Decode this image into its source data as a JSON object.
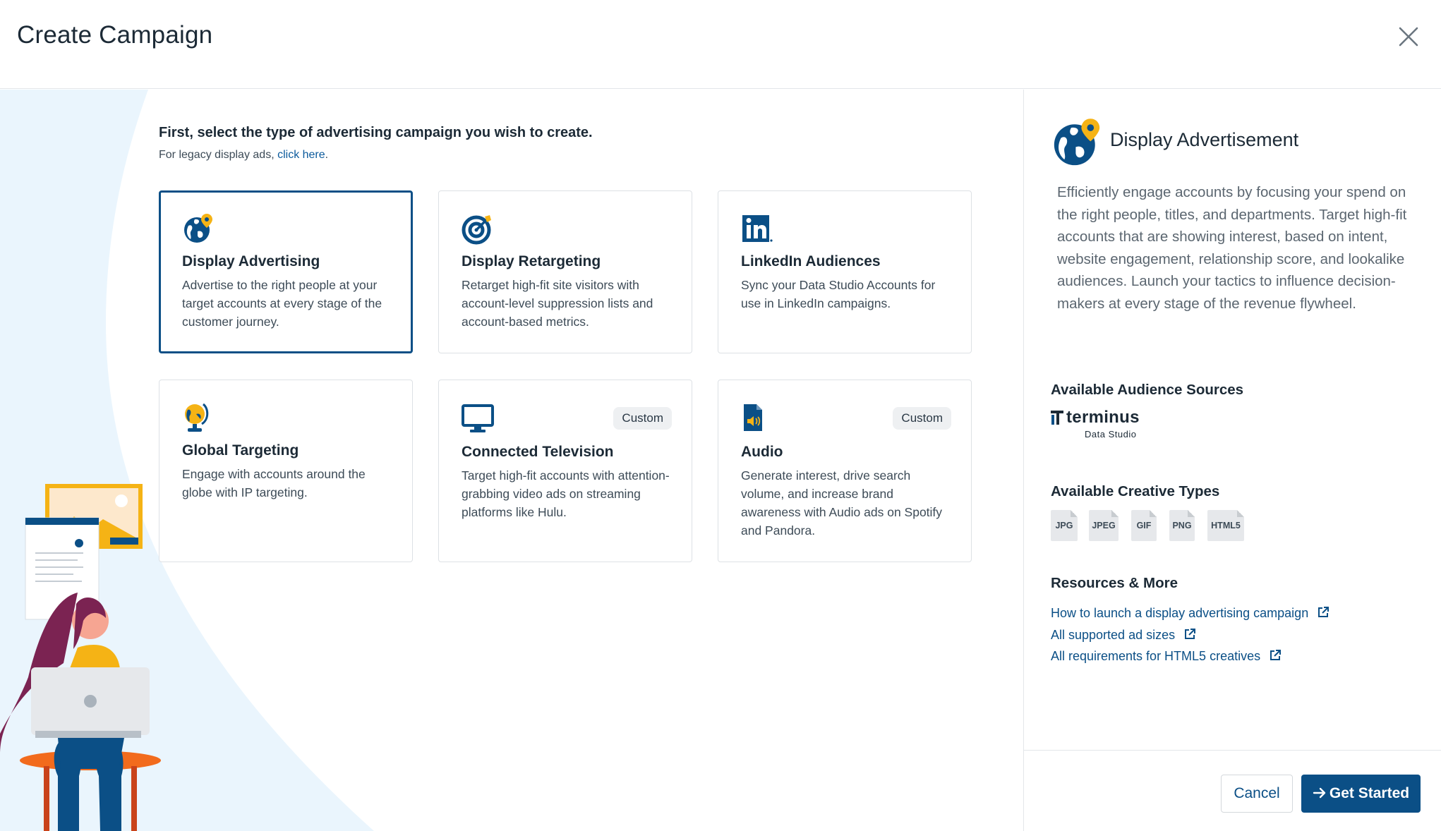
{
  "colors": {
    "accent": "#0b4f86",
    "highlight": "#f5b315",
    "muted_bg": "#eaf5fd"
  },
  "header": {
    "title": "Create Campaign",
    "close_icon": "close-icon"
  },
  "intro": {
    "heading": "First, select the type of advertising campaign you wish to create.",
    "legacy_prefix": "For legacy display ads, ",
    "legacy_link": "click here",
    "legacy_suffix": "."
  },
  "cards": [
    {
      "title": "Display Advertising",
      "desc": "Advertise to the right people at your target accounts at every stage of the customer journey.",
      "icon": "globe-pin-icon",
      "selected": true,
      "badge": ""
    },
    {
      "title": "Display Retargeting",
      "desc": "Retarget high-fit site visitors with account-level suppression lists and account-based metrics.",
      "icon": "target-icon",
      "selected": false,
      "badge": ""
    },
    {
      "title": "LinkedIn Audiences",
      "desc": "Sync your Data Studio Accounts for use in LinkedIn campaigns.",
      "icon": "linkedin-icon",
      "selected": false,
      "badge": ""
    },
    {
      "title": "Global Targeting",
      "desc": "Engage with accounts around the globe with IP targeting.",
      "icon": "desk-globe-icon",
      "selected": false,
      "badge": ""
    },
    {
      "title": "Connected Television",
      "desc": "Target high-fit accounts with attention-grabbing video ads on streaming platforms like Hulu.",
      "icon": "monitor-icon",
      "selected": false,
      "badge": "Custom"
    },
    {
      "title": "Audio",
      "desc": "Generate interest, drive search volume, and increase brand awareness with Audio ads on Spotify and Pandora.",
      "icon": "audio-file-icon",
      "selected": false,
      "badge": "Custom"
    }
  ],
  "side": {
    "title": "Display Advertisement",
    "icon": "globe-pin-icon",
    "description": "Efficiently engage accounts by focusing your spend on the right people, titles, and departments. Target high-fit accounts that are showing interest, based on intent, website engagement, relationship score, and lookalike audiences. Launch your tactics to influence decision-makers at every stage of the revenue flywheel.",
    "audience_heading": "Available Audience Sources",
    "audience_logo": {
      "word": "terminus",
      "sub": "Data Studio"
    },
    "creative_heading": "Available Creative Types",
    "creative_types": [
      "JPG",
      "JPEG",
      "GIF",
      "PNG",
      "HTML5"
    ],
    "resources_heading": "Resources & More",
    "resources": [
      "How to launch a display advertising campaign",
      "All supported ad sizes",
      "All requirements for HTML5 creatives"
    ]
  },
  "footer": {
    "cancel": "Cancel",
    "start": "Get Started",
    "start_icon": "arrow-right-icon"
  }
}
